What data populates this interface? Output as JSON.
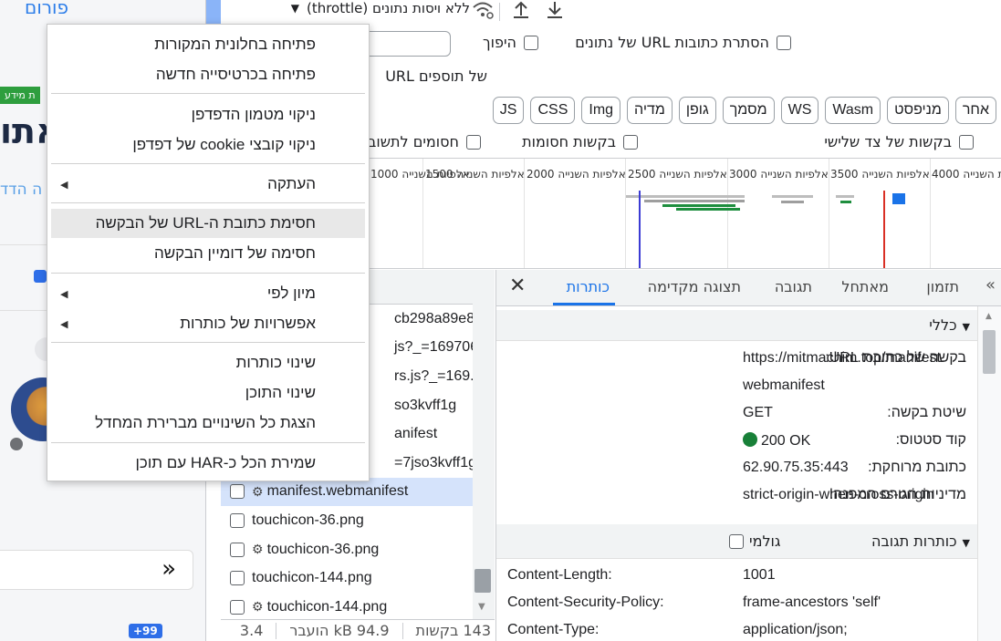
{
  "site": {
    "forum_label": "פורום",
    "badge_label": "ת מידע",
    "big_word": "אתו",
    "sub_line": "ה הדד",
    "expand_symbol": "»",
    "count_badge": "+99"
  },
  "toolbar": {
    "throttle_label": "ללא ויסות נתונים (throttle)",
    "throttle_caret": "▼"
  },
  "filter": {
    "invert_label": "היפוך",
    "hide_data_urls_label": "הסתרת כתובות URL של נתונים",
    "extension_urls_label": "של תוספים URL"
  },
  "chips": [
    "אחר",
    "מניפסט",
    "Wasm",
    "WS",
    "מסמך",
    "גופן",
    "מדיה",
    "Img",
    "CSS",
    "JS"
  ],
  "row5": {
    "third_party_label": "בקשות של צד שלישי",
    "blocked_requests_label": "בקשות חסומות",
    "blocked_response_label": "חסומים לתשוב"
  },
  "timeline": {
    "labels": [
      "ת השנייה",
      "אלפיות השנייה",
      "אלפיות השנייה",
      "אלפיות השנייה",
      "אלפיות השנייה",
      "אלפיות השנייה",
      "אלפיות השנייה"
    ],
    "numbers": [
      "4000",
      "3500",
      "3000",
      "2500",
      "2000",
      "1500",
      "1000"
    ]
  },
  "requests": [
    {
      "name": "cb298a89e8...",
      "gear": false
    },
    {
      "name": "js?_=169706...",
      "gear": false
    },
    {
      "name": "rs.js?_=169...",
      "gear": false
    },
    {
      "name": "so3kvff1g",
      "gear": false
    },
    {
      "name": "anifest",
      "gear": false
    },
    {
      "name": "=7jso3kvff1g",
      "gear": false
    },
    {
      "name": "manifest.webmanifest",
      "gear": true
    },
    {
      "name": "touchicon-36.png",
      "gear": false
    },
    {
      "name": "touchicon-36.png",
      "gear": true
    },
    {
      "name": "touchicon-144.png",
      "gear": false
    },
    {
      "name": "touchicon-144.png",
      "gear": true
    }
  ],
  "statusbar": {
    "requests": "143 בקשות",
    "transferred": "94.9 kB הועבר",
    "more": "3.4"
  },
  "tabs": {
    "more": "»",
    "timing": "תזמון",
    "initiator": "מאתחל",
    "response": "תגובה",
    "preview": "תצוגה מקדימה",
    "headers": "כותרות",
    "close": "✕"
  },
  "general": {
    "title": "כללי",
    "url_key": "בקשה של כתובת URL:",
    "url_val_1": "https://mitmachim.top/manifest.",
    "url_val_2": "webmanifest",
    "method_key": "שיטת בקשה:",
    "method_val": "GET",
    "status_key": "קוד סטטוס:",
    "status_val": "200 OK",
    "remote_key": "כתובת מרוחקת:",
    "remote_val": "62.90.75.35:443",
    "referrer_key": "מדיניות הגורם המפנה:",
    "referrer_val": "strict-origin-when-cross-origin"
  },
  "response_headers": {
    "title": "כותרות תגובה",
    "raw_label": "גולמי",
    "rows": [
      {
        "k": "Content-Length:",
        "v": "1001"
      },
      {
        "k": "Content-Security-Policy:",
        "v": "frame-ancestors 'self'"
      },
      {
        "k": "Content-Type:",
        "v": "application/json;"
      }
    ]
  },
  "menu": {
    "open_in_sources": "פתיחה בחלונית המקורות",
    "open_in_new_tab": "פתיחה בכרטיסייה חדשה",
    "clear_cache": "ניקוי מטמון הדפדפן",
    "clear_cookies": "ניקוי קובצי cookie של דפדפן",
    "copy": "העתקה",
    "block_url": "חסימת כתובת ה-URL של הבקשה",
    "block_domain": "חסימה של דומיין הבקשה",
    "sort_by": "מיון לפי",
    "header_options": "אפשרויות של כותרות",
    "override_headers": "שינוי כותרות",
    "override_content": "שינוי התוכן",
    "show_all_overrides": "הצגת כל השינויים מברירת המחדל",
    "save_har": "שמירת הכל כ-HAR עם תוכן"
  },
  "colors": {
    "accent": "#1a73e8",
    "selected_row": "#d5e3fb",
    "status_ok": "#188038"
  }
}
